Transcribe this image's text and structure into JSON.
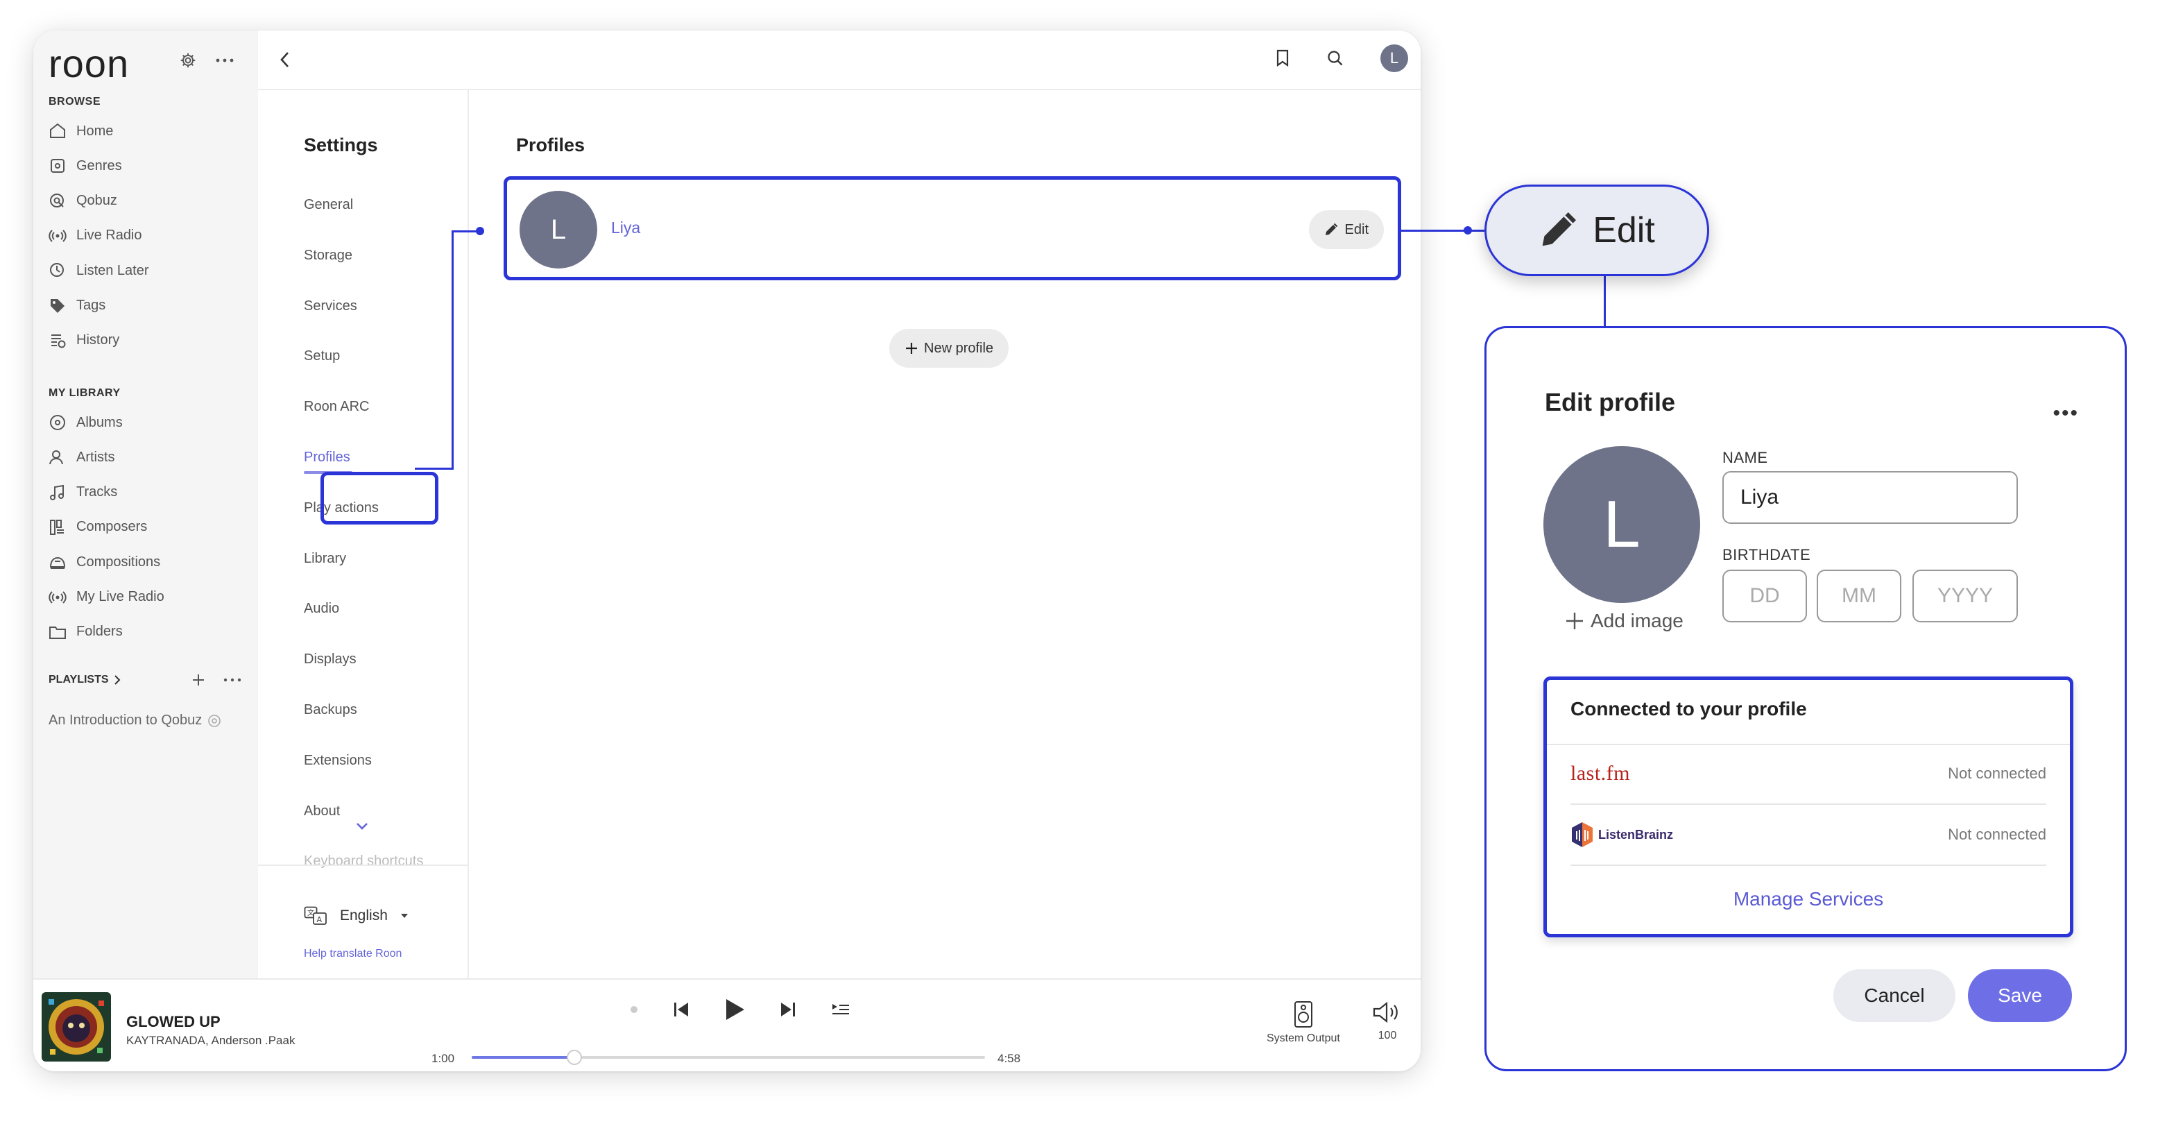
{
  "app": {
    "logo": "roon",
    "sidebar": {
      "browse_header": "BROWSE",
      "browse": [
        {
          "label": "Home",
          "icon": "home-icon"
        },
        {
          "label": "Genres",
          "icon": "genres-icon"
        },
        {
          "label": "Qobuz",
          "icon": "qobuz-icon"
        },
        {
          "label": "Live Radio",
          "icon": "radio-icon"
        },
        {
          "label": "Listen Later",
          "icon": "clock-icon"
        },
        {
          "label": "Tags",
          "icon": "tag-icon"
        },
        {
          "label": "History",
          "icon": "history-icon"
        }
      ],
      "library_header": "MY LIBRARY",
      "library": [
        {
          "label": "Albums",
          "icon": "album-icon"
        },
        {
          "label": "Artists",
          "icon": "artist-icon"
        },
        {
          "label": "Tracks",
          "icon": "music-note-icon"
        },
        {
          "label": "Composers",
          "icon": "composer-icon"
        },
        {
          "label": "Compositions",
          "icon": "composition-icon"
        },
        {
          "label": "My Live Radio",
          "icon": "radio-icon"
        },
        {
          "label": "Folders",
          "icon": "folder-icon"
        }
      ],
      "playlists_header": "PLAYLISTS",
      "playlist_item": "An Introduction to Qobuz"
    },
    "settings": {
      "title": "Settings",
      "items": [
        "General",
        "Storage",
        "Services",
        "Setup",
        "Roon ARC",
        "Profiles",
        "Play actions",
        "Library",
        "Audio",
        "Displays",
        "Backups",
        "Extensions",
        "About",
        "Keyboard shortcuts"
      ],
      "active": "Profiles",
      "language": "English",
      "help_link": "Help translate Roon"
    },
    "content": {
      "title": "Profiles",
      "profile": {
        "initial": "L",
        "name": "Liya",
        "edit_label": "Edit"
      },
      "new_profile_label": "New profile"
    },
    "user_initial": "L",
    "player": {
      "track": "GLOWED UP",
      "artist": "KAYTRANADA, Anderson .Paak",
      "elapsed": "1:00",
      "duration": "4:58",
      "progress": 0.2,
      "output_label": "System Output",
      "volume": "100"
    }
  },
  "zoom": {
    "edit_label": "Edit",
    "panel": {
      "title": "Edit profile",
      "avatar_initial": "L",
      "add_image": "Add image",
      "name_label": "NAME",
      "name_value": "Liya",
      "birthdate_label": "BIRTHDATE",
      "dd": "DD",
      "mm": "MM",
      "yyyy": "YYYY",
      "connected_title": "Connected to your profile",
      "services": [
        {
          "name": "last.fm",
          "status": "Not connected"
        },
        {
          "name": "ListenBrainz",
          "status": "Not connected"
        }
      ],
      "manage": "Manage Services",
      "cancel": "Cancel",
      "save": "Save"
    }
  },
  "colors": {
    "accent": "#6464d8",
    "highlight": "#2b34d6",
    "avatar": "#6f7389",
    "save": "#6e6ee6",
    "lastfm": "#b5251d"
  }
}
